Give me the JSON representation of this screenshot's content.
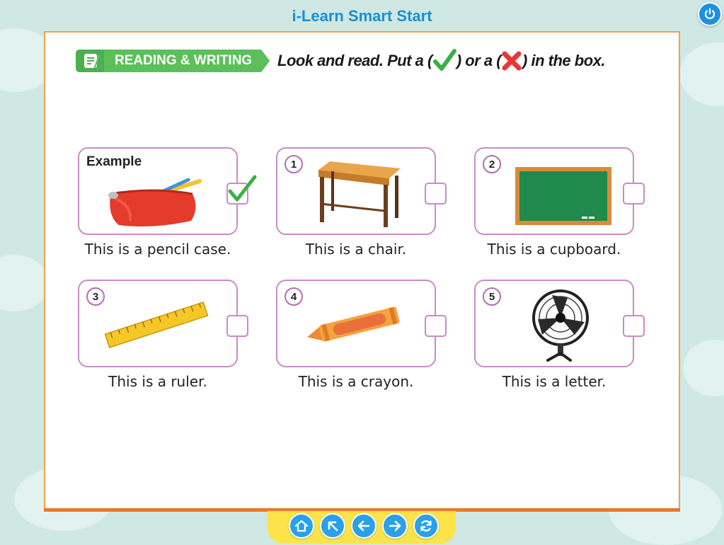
{
  "app": {
    "title": "i-Learn Smart Start"
  },
  "section": {
    "label": "READING & WRITING"
  },
  "instruction": {
    "part1": "Look and read. Put a (",
    "part2": ") or a (",
    "part3": ") in the box."
  },
  "cards": [
    {
      "label": "Example",
      "picture": "pencil-case",
      "sentence": "This is a pencil case.",
      "answer": "tick"
    },
    {
      "label": "1",
      "picture": "desk",
      "sentence": "This is a chair.",
      "answer": ""
    },
    {
      "label": "2",
      "picture": "board",
      "sentence": "This is a cupboard.",
      "answer": ""
    },
    {
      "label": "3",
      "picture": "ruler",
      "sentence": "This is a ruler.",
      "answer": ""
    },
    {
      "label": "4",
      "picture": "crayon",
      "sentence": "This is a crayon.",
      "answer": ""
    },
    {
      "label": "5",
      "picture": "fan",
      "sentence": "This is a letter.",
      "answer": ""
    }
  ],
  "nav": {
    "buttons": [
      {
        "icon": "home-icon"
      },
      {
        "icon": "arrow-up-left-icon"
      },
      {
        "icon": "arrow-left-icon"
      },
      {
        "icon": "arrow-right-icon"
      },
      {
        "icon": "refresh-icon"
      }
    ]
  },
  "colors": {
    "title": "#1c8fd0",
    "page_border": "#f0a04b",
    "card_border": "#c98bc9",
    "section_tag": "#4caf50",
    "nav_bar": "#fde34a",
    "nav_button": "#2aa0e8"
  }
}
